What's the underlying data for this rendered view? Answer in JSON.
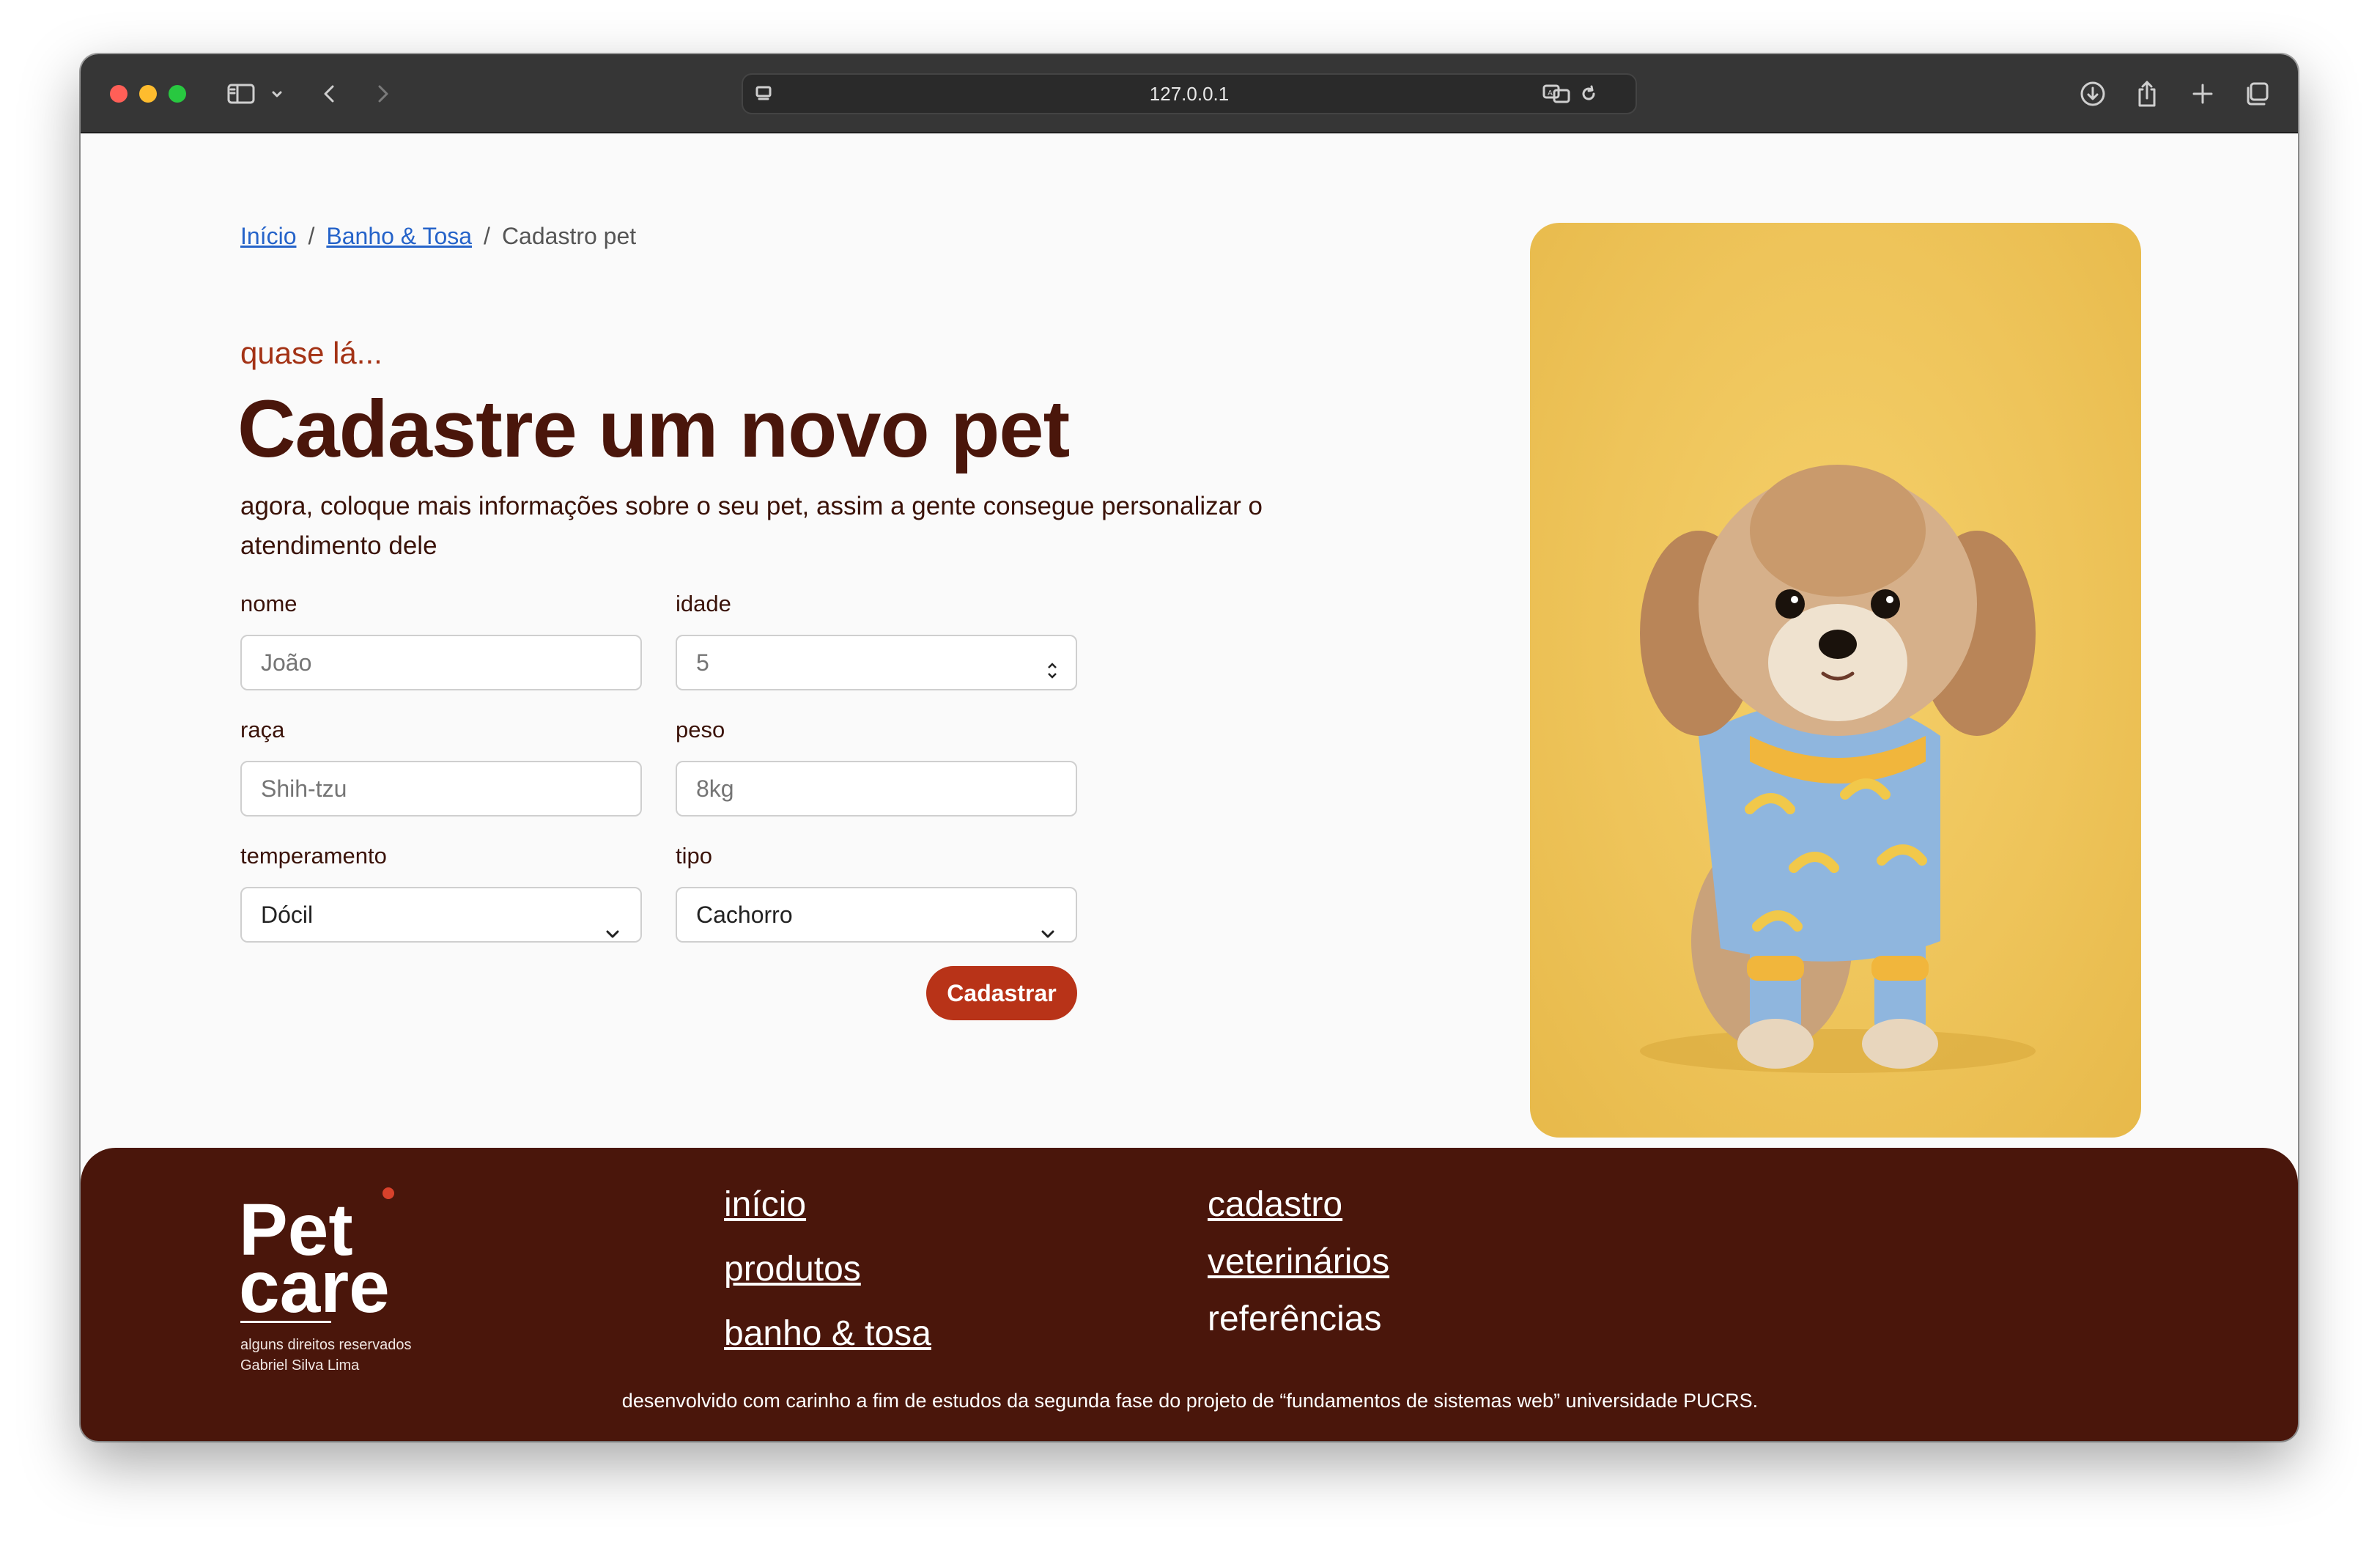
{
  "browser": {
    "url": "127.0.0.1"
  },
  "breadcrumb": {
    "items": [
      "Início",
      "Banho & Tosa",
      "Cadastro pet"
    ],
    "separator": "/"
  },
  "hero": {
    "eyebrow": "quase lá...",
    "title": "Cadastre um novo pet",
    "description": "agora, coloque mais informações sobre o seu pet, assim a gente consegue personalizar o atendimento dele"
  },
  "form": {
    "nome": {
      "label": "nome",
      "placeholder": "João"
    },
    "idade": {
      "label": "idade",
      "placeholder": "5"
    },
    "raca": {
      "label": "raça",
      "placeholder": "Shih-tzu"
    },
    "peso": {
      "label": "peso",
      "placeholder": "8kg"
    },
    "temperamento": {
      "label": "temperamento",
      "selected": "Dócil"
    },
    "tipo": {
      "label": "tipo",
      "selected": "Cachorro"
    },
    "submit_label": "Cadastrar"
  },
  "footer": {
    "logo_line1": "Pet",
    "logo_line2": "care",
    "rights": "alguns direitos reservados",
    "author": "Gabriel Silva Lima",
    "links_col1": [
      "início",
      "produtos",
      "banho & tosa"
    ],
    "links_col2": [
      "cadastro",
      "veterinários",
      "referências"
    ],
    "note": "desenvolvido com carinho a fim de estudos da segunda fase do projeto de “fundamentos de sistemas web” universidade PUCRS."
  },
  "colors": {
    "accent": "#b83318",
    "brand_dark": "#4a160b",
    "photo_bg": "#eec45a"
  }
}
